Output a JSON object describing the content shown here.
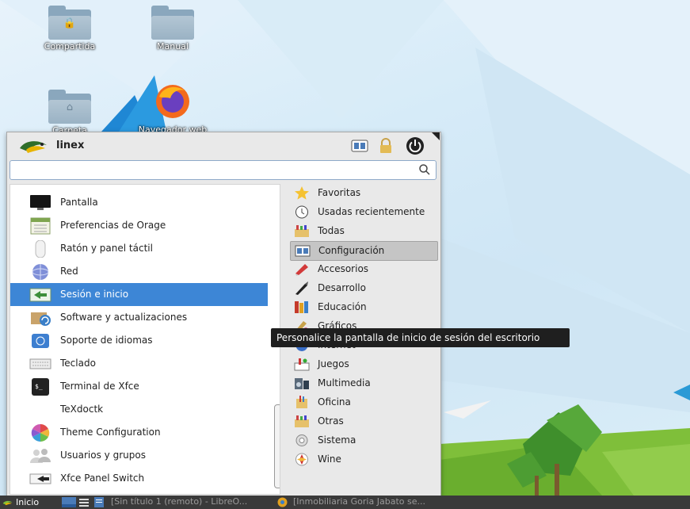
{
  "desktop": {
    "icons": [
      {
        "label": "Compartida"
      },
      {
        "label": "Manual"
      },
      {
        "label": "Carpeta"
      },
      {
        "label": "Navegador web"
      }
    ]
  },
  "menu": {
    "user": "linex",
    "search": {
      "value": "",
      "placeholder": ""
    },
    "apps": [
      {
        "label": "Pantalla",
        "icon": "monitor-icon"
      },
      {
        "label": "Preferencias de Orage",
        "icon": "calendar-icon"
      },
      {
        "label": "Ratón y panel táctil",
        "icon": "mouse-icon"
      },
      {
        "label": "Red",
        "icon": "network-icon"
      },
      {
        "label": "Sesión e inicio",
        "icon": "session-icon"
      },
      {
        "label": "Software y actualizaciones",
        "icon": "software-update-icon"
      },
      {
        "label": "Soporte de idiomas",
        "icon": "language-icon"
      },
      {
        "label": "Teclado",
        "icon": "keyboard-icon"
      },
      {
        "label": "Terminal de Xfce",
        "icon": "terminal-icon"
      },
      {
        "label": "TeXdoctk",
        "icon": "texdoc-icon"
      },
      {
        "label": "Theme Configuration",
        "icon": "theme-icon"
      },
      {
        "label": "Usuarios y grupos",
        "icon": "users-icon"
      },
      {
        "label": "Xfce Panel Switch",
        "icon": "panel-switch-icon"
      }
    ],
    "selected_app": "Sesión e inicio",
    "categories": [
      {
        "label": "Favoritas",
        "icon": "star-icon"
      },
      {
        "label": "Usadas recientemente",
        "icon": "clock-icon"
      },
      {
        "label": "Todas",
        "icon": "all-apps-icon"
      },
      {
        "label": "Configuración",
        "icon": "settings-icon"
      },
      {
        "label": "Accesorios",
        "icon": "accessories-icon"
      },
      {
        "label": "Desarrollo",
        "icon": "development-icon"
      },
      {
        "label": "Educación",
        "icon": "education-icon"
      },
      {
        "label": "Gráficos",
        "icon": "graphics-icon"
      },
      {
        "label": "Internet",
        "icon": "internet-icon"
      },
      {
        "label": "Juegos",
        "icon": "games-icon"
      },
      {
        "label": "Multimedia",
        "icon": "multimedia-icon"
      },
      {
        "label": "Oficina",
        "icon": "office-icon"
      },
      {
        "label": "Otras",
        "icon": "other-icon"
      },
      {
        "label": "Sistema",
        "icon": "system-icon"
      },
      {
        "label": "Wine",
        "icon": "wine-icon"
      }
    ],
    "selected_category": "Configuración",
    "tooltip": "Personalice la pantalla de inicio de sesión del escritorio"
  },
  "taskbar": {
    "start_label": "Inicio",
    "tasks": [
      {
        "label": "[Sin título 1 (remoto) - LibreO..."
      },
      {
        "label": "[Inmobiliaria Goria Jabato se..."
      }
    ]
  },
  "colors": {
    "selection": "#3d86d6",
    "category_selection": "#c5c5c5",
    "taskbar": "#3a3a3a",
    "tooltip": "#1f1f1f"
  }
}
